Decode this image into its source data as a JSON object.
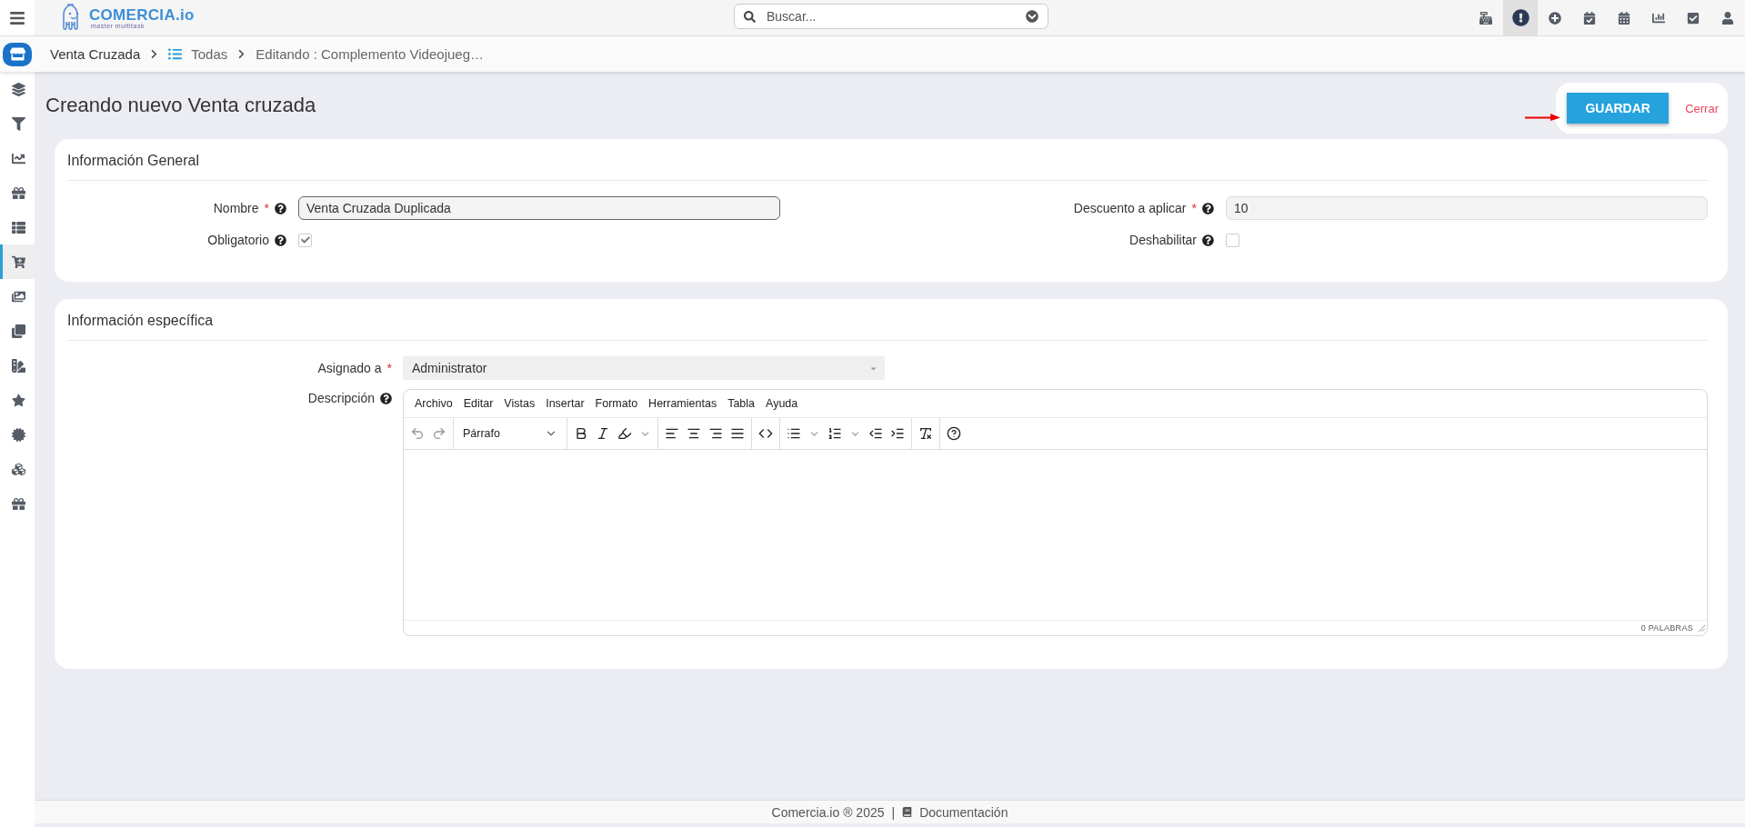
{
  "topbar": {
    "brand": "COMERCIA",
    "brand_suffix": ".io",
    "tagline": "master multitask",
    "search": {
      "placeholder": "Buscar..."
    },
    "icons": [
      {
        "kind": "register",
        "selected": false
      },
      {
        "kind": "alert",
        "selected": true
      },
      {
        "kind": "add",
        "selected": false
      },
      {
        "kind": "calendar-check",
        "selected": false
      },
      {
        "kind": "calendar",
        "selected": false
      },
      {
        "kind": "chart",
        "selected": false
      },
      {
        "kind": "check",
        "selected": false
      },
      {
        "kind": "user",
        "selected": false
      }
    ]
  },
  "sidebar": {
    "items": [
      {
        "kind": "layers",
        "selected": false
      },
      {
        "kind": "filter",
        "selected": false
      },
      {
        "kind": "chart-line",
        "selected": false
      },
      {
        "kind": "gift",
        "selected": false
      },
      {
        "kind": "list",
        "selected": false
      },
      {
        "kind": "cart",
        "selected": true
      },
      {
        "kind": "images",
        "selected": false
      },
      {
        "kind": "clone",
        "selected": false
      },
      {
        "kind": "swatch",
        "selected": false
      },
      {
        "kind": "star",
        "selected": false
      },
      {
        "kind": "certificate",
        "selected": false
      },
      {
        "kind": "gifts",
        "selected": false
      },
      {
        "kind": "gift",
        "selected": false
      }
    ]
  },
  "breadcrumb": [
    {
      "label": "Venta Cruzada",
      "kind": "module"
    },
    {
      "label": "Todas",
      "kind": "list"
    },
    {
      "label": "Editando : Complemento Videojueg…",
      "kind": "current"
    }
  ],
  "page_title": "Creando nuevo Venta cruzada",
  "actions": {
    "save": "GUARDAR",
    "close": "Cerrar"
  },
  "general": {
    "title": "Información General",
    "left": [
      {
        "kind": "text",
        "label": "Nombre",
        "required_mark": "*",
        "help": true,
        "value": "Venta Cruzada Duplicada",
        "disabled": false
      },
      {
        "kind": "checkbox",
        "label": "Obligatorio",
        "help": true,
        "checked": true
      }
    ],
    "right": [
      {
        "kind": "text",
        "label": "Descuento a aplicar",
        "required_mark": "*",
        "help": true,
        "value": "10",
        "disabled": true
      },
      {
        "kind": "checkbox",
        "label": "Deshabilitar",
        "help": true,
        "checked": false
      }
    ]
  },
  "specific": {
    "title": "Información específica",
    "fields": [
      {
        "kind": "select",
        "label": "Asignado a",
        "required_mark": "*",
        "help": false,
        "value": "Administrator"
      },
      {
        "kind": "editor",
        "label": "Descripción",
        "help": true,
        "menu": [
          "Archivo",
          "Editar",
          "Vistas",
          "Insertar",
          "Formato",
          "Herramientas",
          "Tabla",
          "Ayuda"
        ],
        "block_format": "Párrafo",
        "word_count": "0 PALABRAS"
      }
    ]
  },
  "footer": {
    "copyright": "Comercia.io ® 2025",
    "separator": "|",
    "link": "Documentación"
  }
}
